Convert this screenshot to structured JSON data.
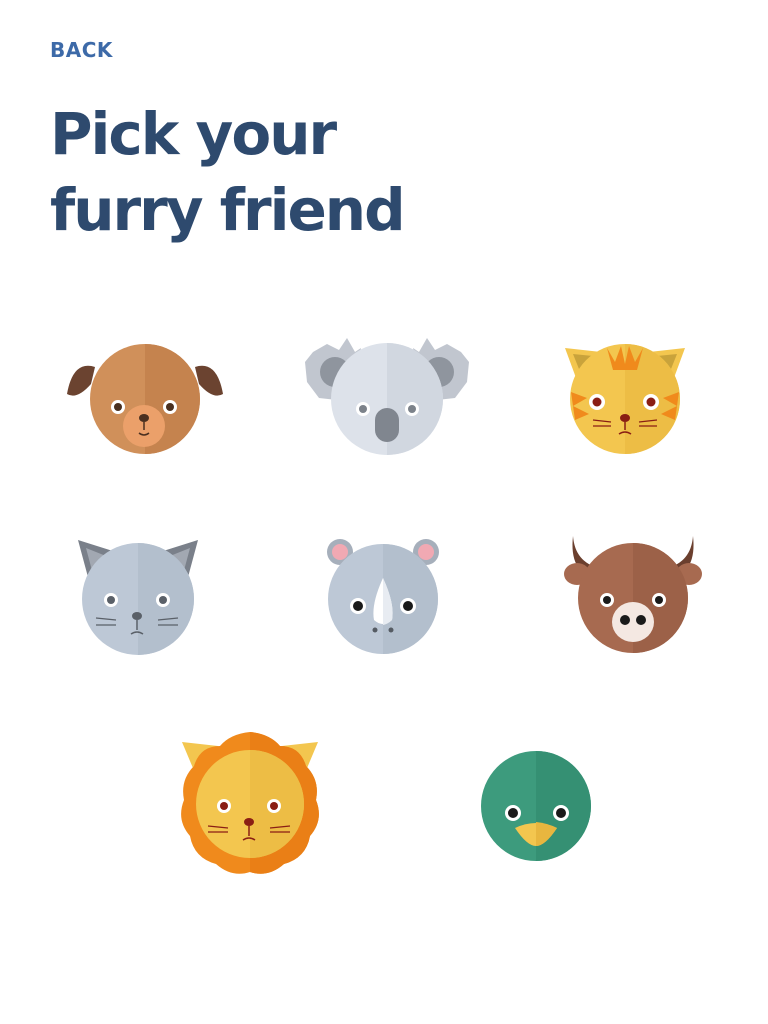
{
  "nav": {
    "back_label": "BACK"
  },
  "heading": {
    "line1": "Pick your",
    "line2": "furry friend"
  },
  "animals": [
    {
      "name": "dog",
      "icon": "dog-face-icon",
      "color": "#d0905a"
    },
    {
      "name": "koala",
      "icon": "koala-face-icon",
      "color": "#dde2ea"
    },
    {
      "name": "tiger",
      "icon": "tiger-face-icon",
      "color": "#f3c64f"
    },
    {
      "name": "cat",
      "icon": "cat-face-icon",
      "color": "#bdc8d6"
    },
    {
      "name": "rhino",
      "icon": "rhino-face-icon",
      "color": "#bdc8d6"
    },
    {
      "name": "bison",
      "icon": "bison-face-icon",
      "color": "#a76a50"
    },
    {
      "name": "lion",
      "icon": "lion-face-icon",
      "color": "#f3c64f"
    },
    {
      "name": "duck",
      "icon": "duck-face-icon",
      "color": "#3d9b7d"
    }
  ],
  "colors": {
    "back": "#3d6aa8",
    "title": "#2e4a6e",
    "background": "#ffffff"
  }
}
